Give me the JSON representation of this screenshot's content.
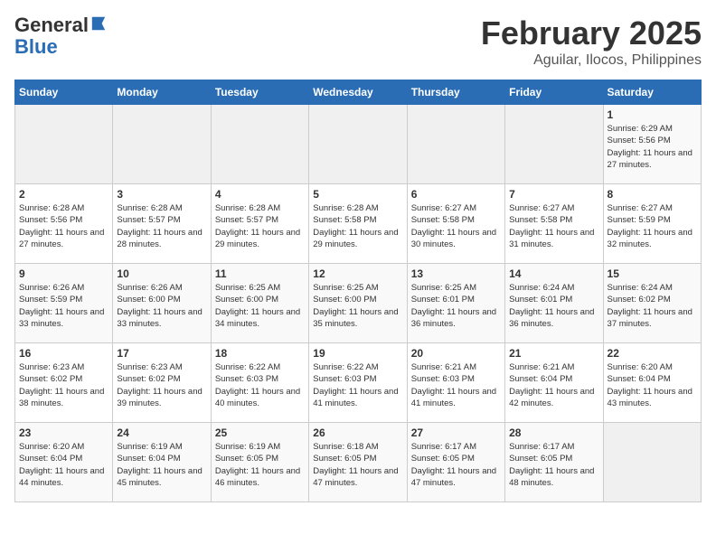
{
  "logo": {
    "general": "General",
    "blue": "Blue"
  },
  "header": {
    "month": "February 2025",
    "location": "Aguilar, Ilocos, Philippines"
  },
  "weekdays": [
    "Sunday",
    "Monday",
    "Tuesday",
    "Wednesday",
    "Thursday",
    "Friday",
    "Saturday"
  ],
  "weeks": [
    [
      {
        "day": "",
        "info": ""
      },
      {
        "day": "",
        "info": ""
      },
      {
        "day": "",
        "info": ""
      },
      {
        "day": "",
        "info": ""
      },
      {
        "day": "",
        "info": ""
      },
      {
        "day": "",
        "info": ""
      },
      {
        "day": "1",
        "info": "Sunrise: 6:29 AM\nSunset: 5:56 PM\nDaylight: 11 hours and 27 minutes."
      }
    ],
    [
      {
        "day": "2",
        "info": "Sunrise: 6:28 AM\nSunset: 5:56 PM\nDaylight: 11 hours and 27 minutes."
      },
      {
        "day": "3",
        "info": "Sunrise: 6:28 AM\nSunset: 5:57 PM\nDaylight: 11 hours and 28 minutes."
      },
      {
        "day": "4",
        "info": "Sunrise: 6:28 AM\nSunset: 5:57 PM\nDaylight: 11 hours and 29 minutes."
      },
      {
        "day": "5",
        "info": "Sunrise: 6:28 AM\nSunset: 5:58 PM\nDaylight: 11 hours and 29 minutes."
      },
      {
        "day": "6",
        "info": "Sunrise: 6:27 AM\nSunset: 5:58 PM\nDaylight: 11 hours and 30 minutes."
      },
      {
        "day": "7",
        "info": "Sunrise: 6:27 AM\nSunset: 5:58 PM\nDaylight: 11 hours and 31 minutes."
      },
      {
        "day": "8",
        "info": "Sunrise: 6:27 AM\nSunset: 5:59 PM\nDaylight: 11 hours and 32 minutes."
      }
    ],
    [
      {
        "day": "9",
        "info": "Sunrise: 6:26 AM\nSunset: 5:59 PM\nDaylight: 11 hours and 33 minutes."
      },
      {
        "day": "10",
        "info": "Sunrise: 6:26 AM\nSunset: 6:00 PM\nDaylight: 11 hours and 33 minutes."
      },
      {
        "day": "11",
        "info": "Sunrise: 6:25 AM\nSunset: 6:00 PM\nDaylight: 11 hours and 34 minutes."
      },
      {
        "day": "12",
        "info": "Sunrise: 6:25 AM\nSunset: 6:00 PM\nDaylight: 11 hours and 35 minutes."
      },
      {
        "day": "13",
        "info": "Sunrise: 6:25 AM\nSunset: 6:01 PM\nDaylight: 11 hours and 36 minutes."
      },
      {
        "day": "14",
        "info": "Sunrise: 6:24 AM\nSunset: 6:01 PM\nDaylight: 11 hours and 36 minutes."
      },
      {
        "day": "15",
        "info": "Sunrise: 6:24 AM\nSunset: 6:02 PM\nDaylight: 11 hours and 37 minutes."
      }
    ],
    [
      {
        "day": "16",
        "info": "Sunrise: 6:23 AM\nSunset: 6:02 PM\nDaylight: 11 hours and 38 minutes."
      },
      {
        "day": "17",
        "info": "Sunrise: 6:23 AM\nSunset: 6:02 PM\nDaylight: 11 hours and 39 minutes."
      },
      {
        "day": "18",
        "info": "Sunrise: 6:22 AM\nSunset: 6:03 PM\nDaylight: 11 hours and 40 minutes."
      },
      {
        "day": "19",
        "info": "Sunrise: 6:22 AM\nSunset: 6:03 PM\nDaylight: 11 hours and 41 minutes."
      },
      {
        "day": "20",
        "info": "Sunrise: 6:21 AM\nSunset: 6:03 PM\nDaylight: 11 hours and 41 minutes."
      },
      {
        "day": "21",
        "info": "Sunrise: 6:21 AM\nSunset: 6:04 PM\nDaylight: 11 hours and 42 minutes."
      },
      {
        "day": "22",
        "info": "Sunrise: 6:20 AM\nSunset: 6:04 PM\nDaylight: 11 hours and 43 minutes."
      }
    ],
    [
      {
        "day": "23",
        "info": "Sunrise: 6:20 AM\nSunset: 6:04 PM\nDaylight: 11 hours and 44 minutes."
      },
      {
        "day": "24",
        "info": "Sunrise: 6:19 AM\nSunset: 6:04 PM\nDaylight: 11 hours and 45 minutes."
      },
      {
        "day": "25",
        "info": "Sunrise: 6:19 AM\nSunset: 6:05 PM\nDaylight: 11 hours and 46 minutes."
      },
      {
        "day": "26",
        "info": "Sunrise: 6:18 AM\nSunset: 6:05 PM\nDaylight: 11 hours and 47 minutes."
      },
      {
        "day": "27",
        "info": "Sunrise: 6:17 AM\nSunset: 6:05 PM\nDaylight: 11 hours and 47 minutes."
      },
      {
        "day": "28",
        "info": "Sunrise: 6:17 AM\nSunset: 6:05 PM\nDaylight: 11 hours and 48 minutes."
      },
      {
        "day": "",
        "info": ""
      }
    ]
  ]
}
